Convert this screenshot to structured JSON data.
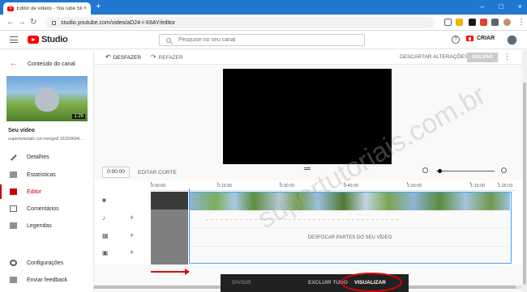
{
  "browser": {
    "tab_title": "Editor de vídeos - YouTube Studi",
    "url": "studio.youtube.com/video/aD24-i-X8AY/editor",
    "new_tab": "+",
    "close": "×"
  },
  "header": {
    "logo_text": "Studio",
    "search_placeholder": "Pesquise no seu canal",
    "help_label": "?",
    "create_label": "CRIAR"
  },
  "sidebar": {
    "back_label": "Conteúdo do canal",
    "video_duration": "1:26",
    "video_title": "Seu vídeo",
    "video_subtitle": "supertutorials cut merged 16269684...",
    "items": [
      {
        "label": "Detalhes",
        "icon": "pencil-icon"
      },
      {
        "label": "Estatísticas",
        "icon": "bar-chart-icon"
      },
      {
        "label": "Editor",
        "icon": "film-icon",
        "active": true
      },
      {
        "label": "Comentários",
        "icon": "comment-icon"
      },
      {
        "label": "Legendas",
        "icon": "subtitles-icon"
      }
    ],
    "bottom_items": [
      {
        "label": "Configurações",
        "icon": "gear-icon"
      },
      {
        "label": "Enviar feedback",
        "icon": "feedback-icon"
      }
    ]
  },
  "toolbar": {
    "undo_label": "DESFAZER",
    "redo_label": "REFAZER",
    "discard_label": "DESCARTAR ALTERAÇÕES",
    "save_label": "SALVAR",
    "more_label": "⋮"
  },
  "timebar": {
    "timecode": "0:00:00",
    "edit_cut_label": "EDITAR CORTE"
  },
  "timeline": {
    "ticks": [
      "0:00:00",
      "0:15:00",
      "0:30:00",
      "0:45:00",
      "1:00:00",
      "1:15:00",
      "1:25:03"
    ],
    "blur_label": "DESFOCAR PARTES DO SEU VÍDEO"
  },
  "bottom_bar": {
    "divide_label": "DIVIDIR",
    "clear_all_label": "EXCLUIR TUDO",
    "preview_label": "VISUALIZAR"
  },
  "watermark": "supertutoriais.com.br",
  "colors": {
    "chrome_blue": "#1f77d0",
    "yt_red": "#ff0000",
    "active_red": "#cc0000",
    "playhead_blue": "#3ea6ff",
    "annotation_red": "#e00000"
  }
}
